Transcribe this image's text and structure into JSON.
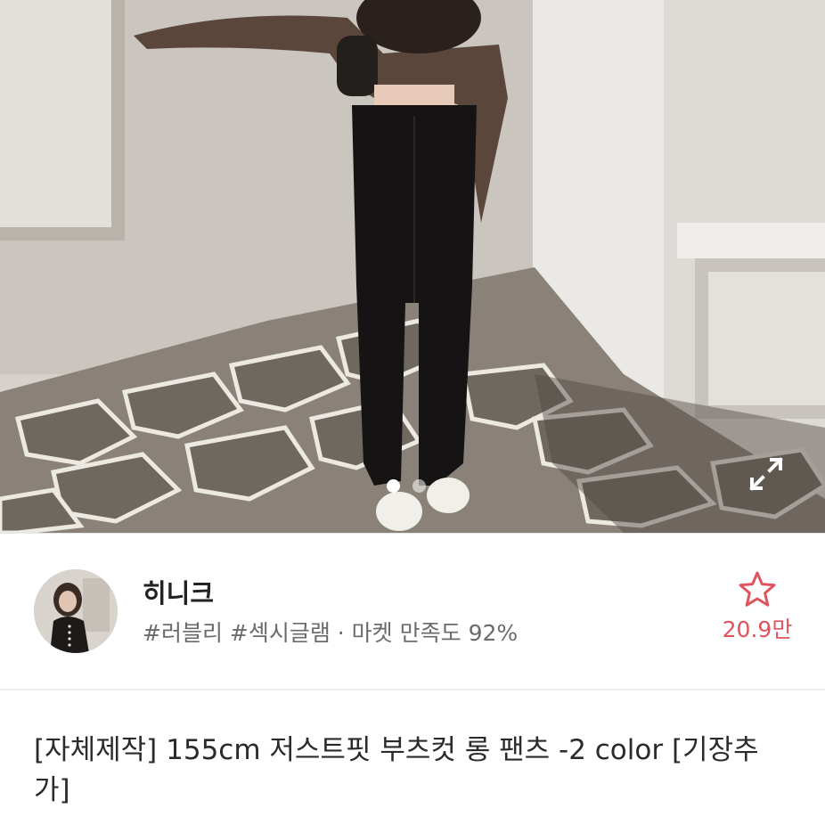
{
  "product_image": {
    "alt": "product photo",
    "page_dots": 2,
    "active_dot": 1
  },
  "shop": {
    "name": "히니크",
    "tags": "#러블리 #섹시글램 · 마켓 만족도 92%",
    "favorite_count": "20.9만",
    "favorite_icon": "star-outline-icon",
    "accent_color": "#e0545e"
  },
  "product": {
    "title": "[자체제작] 155cm 저스트핏 부츠컷 롱 팬츠 -2 color [기장추가]"
  },
  "icons": {
    "expand": "expand-icon"
  }
}
